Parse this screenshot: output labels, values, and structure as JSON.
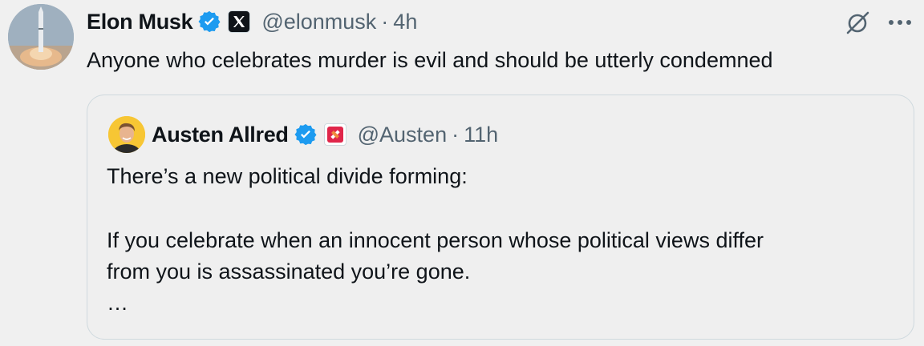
{
  "author": {
    "name": "Elon Musk",
    "handle": "@elonmusk",
    "separator": "·",
    "time": "4h",
    "verified_icon": "verified-badge-icon",
    "affiliation_icon": "x-logo-icon",
    "avatar_icon": "rocket-launch-avatar"
  },
  "tweet": {
    "text": "Anyone who celebrates murder is evil and should be utterly condemned"
  },
  "actions": {
    "grok_icon": "grok-icon",
    "more_icon": "more-dots-icon"
  },
  "quoted": {
    "name": "Austen Allred",
    "handle": "@Austen",
    "separator": "·",
    "time": "11h",
    "verified_icon": "verified-badge-icon",
    "affiliation_icon": "gauntlet-logo-icon",
    "line1": "There’s a new political divide forming:",
    "line2": "If you celebrate when an innocent person whose political views differ",
    "line3": "from you is assassinated you’re gone.",
    "line4": "…"
  },
  "colors": {
    "background": "#f0f0f0",
    "text_primary": "#0f1419",
    "text_secondary": "#536471",
    "verified_blue": "#1d9bf0",
    "border": "#cfd9de"
  }
}
